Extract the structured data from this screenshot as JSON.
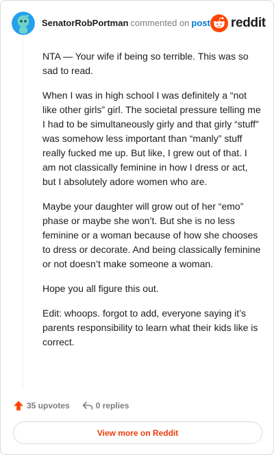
{
  "header": {
    "username": "SenatorRobPortman",
    "action_text": "commented on",
    "post_link": "post",
    "brand_name": "reddit"
  },
  "comment": {
    "paragraphs": [
      "NTA — Your wife if being so terrible. This was so sad to read.",
      "When I was in high school I was definitely a “not like other girls” girl. The societal pressure telling me I had to be simultaneously girly and that girly “stuff” was somehow less important than “manly” stuff really fucked me up. But like, I grew out of that. I am not classically feminine in how I dress or act, but I absolutely adore women who are.",
      "Maybe your daughter will grow out of her “emo” phase or maybe she won’t. But she is no less feminine or a woman because of how she chooses to dress or decorate. And being classically feminine or not doesn’t make someone a woman.",
      "Hope you all figure this out.",
      "Edit: whoops. forgot to add, everyone saying it’s parents responsibility to learn what their kids like is correct."
    ]
  },
  "actions": {
    "upvotes_label": "35 upvotes",
    "replies_label": "0 replies"
  },
  "footer": {
    "view_more_label": "View more on Reddit"
  },
  "colors": {
    "brand_orange": "#ff4500",
    "link_blue": "#0079d3",
    "view_more_text": "#ed3b08",
    "avatar_bg": "#24a0ed"
  },
  "icons": {
    "avatar": "snoo-avatar-icon",
    "brand": "reddit-logo-icon",
    "upvote": "upvote-arrow-icon",
    "reply": "reply-arrow-icon"
  }
}
